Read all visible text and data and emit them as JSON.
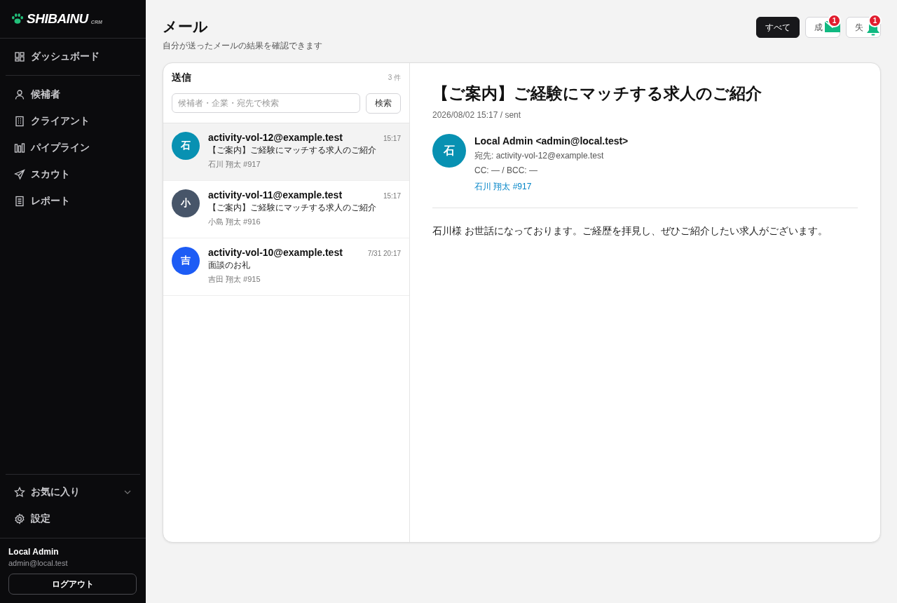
{
  "sidebar": {
    "logo": {
      "name": "SHIBAINU",
      "sub": "CRM"
    },
    "top_items": [
      {
        "label": "ダッシュボード",
        "kind": "dashboard",
        "selected": false
      }
    ],
    "items": [
      {
        "label": "候補者",
        "kind": "person",
        "selected": false
      },
      {
        "label": "クライアント",
        "kind": "building",
        "selected": false
      },
      {
        "label": "パイプライン",
        "kind": "bars",
        "selected": false
      },
      {
        "label": "スカウト",
        "kind": "send",
        "selected": false
      },
      {
        "label": "レポート",
        "kind": "doc",
        "selected": false
      }
    ],
    "favorites": {
      "label": "お気に入り",
      "expanded": false
    },
    "settings": {
      "label": "設定"
    },
    "user": {
      "name": "Local Admin",
      "email": "admin@local.test"
    },
    "logout": "ログアウト"
  },
  "header": {
    "title": "メール",
    "subtitle": "自分が送ったメールの結果を確認できます",
    "filters": [
      {
        "label": "すべて",
        "selected": true,
        "kind": "plain"
      },
      {
        "label": "成",
        "selected": false,
        "kind": "mail",
        "badge": "1"
      },
      {
        "label": "失",
        "selected": false,
        "kind": "bell",
        "badge": "1"
      }
    ]
  },
  "list": {
    "title": "送信",
    "count": "3 件",
    "search": {
      "placeholder": "候補者・企業・宛先で検索",
      "button": "検索"
    },
    "items": [
      {
        "avatar": "石",
        "color": "#0891b2",
        "email": "activity-vol-12@example.test",
        "time": "15:17",
        "subject": "【ご案内】ご経験にマッチする求人のご紹介",
        "candidate": "石川 翔太 #917",
        "selected": true
      },
      {
        "avatar": "小",
        "color": "#475569",
        "email": "activity-vol-11@example.test",
        "time": "15:17",
        "subject": "【ご案内】ご経験にマッチする求人のご紹介",
        "candidate": "小島 翔太 #916",
        "selected": false
      },
      {
        "avatar": "吉",
        "color": "#1d5cf5",
        "email": "activity-vol-10@example.test",
        "time": "7/31 20:17",
        "subject": "面談のお礼",
        "candidate": "吉田 翔太 #915",
        "selected": false
      }
    ]
  },
  "detail": {
    "subject": "【ご案内】ご経験にマッチする求人のご紹介",
    "meta": "2026/08/02 15:17 / sent",
    "avatar": "石",
    "color": "#0891b2",
    "from": "Local Admin <admin@local.test>",
    "to": "宛先: activity-vol-12@example.test",
    "cc": "CC: — / BCC: —",
    "candidate": "石川 翔太 #917",
    "body": "石川様 お世話になっております。ご経歴を拝見し、ぜひご紹介したい求人がございます。"
  }
}
